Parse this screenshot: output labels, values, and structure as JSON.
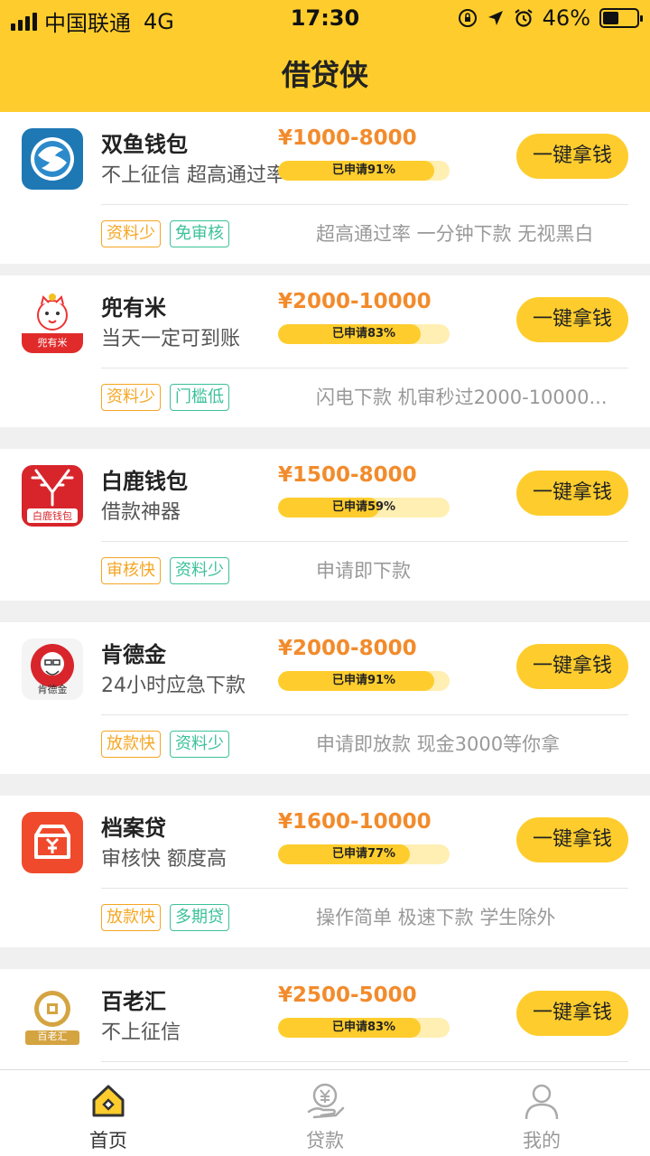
{
  "status_bar": {
    "carrier": "中国联通",
    "network": "4G",
    "time": "17:30",
    "battery": "46%",
    "battery_level": 0.46
  },
  "header": {
    "title": "借贷侠"
  },
  "loans": [
    {
      "name": "双鱼钱包",
      "desc": "不上征信 超高通过率",
      "amount": "¥1000-8000",
      "applied": "已申请91%",
      "applied_pct": 91,
      "button": "一键拿钱",
      "tags": [
        "资料少",
        "免审核"
      ],
      "tag_colors": [
        "orange",
        "green"
      ],
      "slogan": "超高通过率 一分钟下款 无视黑白",
      "logo_text": ""
    },
    {
      "name": "兜有米",
      "desc": "当天一定可到账",
      "amount": "¥2000-10000",
      "applied": "已申请83%",
      "applied_pct": 83,
      "button": "一键拿钱",
      "tags": [
        "资料少",
        "门槛低"
      ],
      "tag_colors": [
        "orange",
        "green"
      ],
      "slogan": "闪电下款 机审秒过2000-10000...",
      "logo_text": "兜有米"
    },
    {
      "name": "白鹿钱包",
      "desc": "借款神器",
      "amount": "¥1500-8000",
      "applied": "已申请59%",
      "applied_pct": 59,
      "button": "一键拿钱",
      "tags": [
        "审核快",
        "资料少"
      ],
      "tag_colors": [
        "orange",
        "green"
      ],
      "slogan": "申请即下款",
      "logo_text": "白鹿钱包"
    },
    {
      "name": "肯德金",
      "desc": "24小时应急下款",
      "amount": "¥2000-8000",
      "applied": "已申请91%",
      "applied_pct": 91,
      "button": "一键拿钱",
      "tags": [
        "放款快",
        "资料少"
      ],
      "tag_colors": [
        "orange",
        "green"
      ],
      "slogan": "申请即放款 现金3000等你拿",
      "logo_text": "肯德金"
    },
    {
      "name": "档案贷",
      "desc": "审核快 额度高",
      "amount": "¥1600-10000",
      "applied": "已申请77%",
      "applied_pct": 77,
      "button": "一键拿钱",
      "tags": [
        "放款快",
        "多期贷"
      ],
      "tag_colors": [
        "orange",
        "green"
      ],
      "slogan": "操作简单 极速下款 学生除外",
      "logo_text": ""
    },
    {
      "name": "百老汇",
      "desc": "不上征信",
      "amount": "¥2500-5000",
      "applied": "已申请83%",
      "applied_pct": 83,
      "button": "一键拿钱",
      "tags": [],
      "tag_colors": [],
      "slogan": "",
      "logo_text": "百老汇"
    }
  ],
  "tabbar": [
    {
      "label": "首页",
      "icon": "home-icon",
      "active": true
    },
    {
      "label": "贷款",
      "icon": "loan-yen-icon",
      "active": false
    },
    {
      "label": "我的",
      "icon": "user-icon",
      "active": false
    }
  ],
  "colors": {
    "accent": "#FECD2D",
    "amount": "#F28B2C",
    "tag_orange": "#F5A623",
    "tag_green": "#3CC19A"
  }
}
